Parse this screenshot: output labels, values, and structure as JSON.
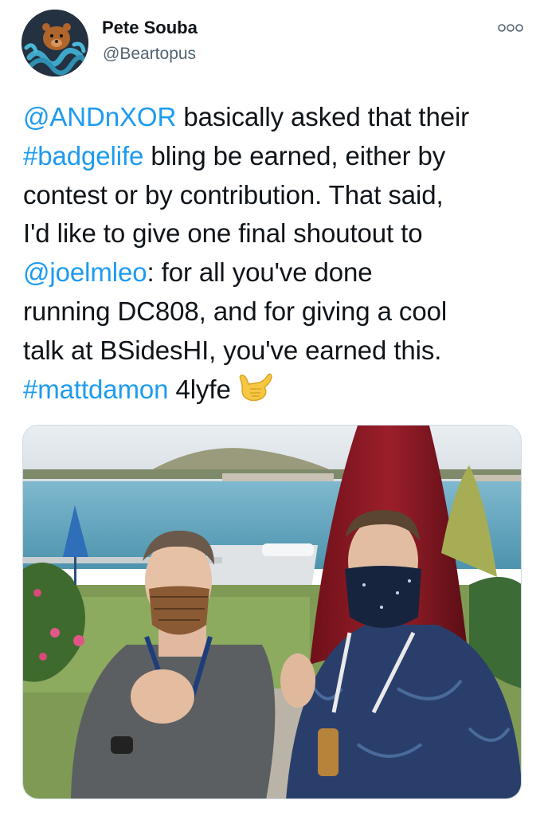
{
  "author": {
    "display_name": "Pete Souba",
    "handle": "@Beartopus",
    "avatar_icon": "bear-octopus-avatar"
  },
  "more_icon": "more-dots-icon",
  "tweet": {
    "lines": [
      {
        "mention": "@ANDnXOR",
        "text": " basically asked that their"
      },
      {
        "hashtag": "#badgelife",
        "text": " bling be earned, either by"
      },
      {
        "text": "contest or by contribution. That said,"
      },
      {
        "text": "I'd like to give one final shoutout to"
      },
      {
        "mention": "@joelmleo",
        "text": ":  for all you've done"
      },
      {
        "text": "running DC808, and for giving a cool"
      },
      {
        "text": "talk at BSidesHI, you've earned this."
      },
      {
        "hashtag": "#mattdamon",
        "text": " 4lyfe",
        "emoji": "shaka-hand-emoji"
      }
    ]
  },
  "media": {
    "type": "photo"
  },
  "colors": {
    "link": "#1d9bf0",
    "text": "#0f1419",
    "secondary": "#536471"
  }
}
